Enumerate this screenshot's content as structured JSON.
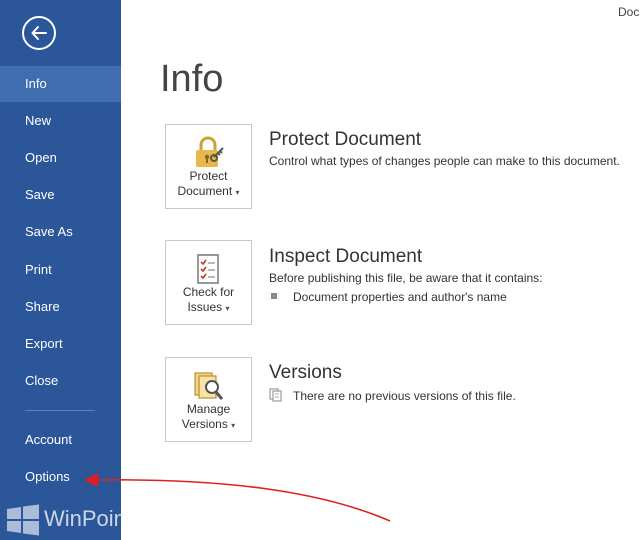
{
  "window": {
    "title_fragment": "Doc"
  },
  "sidebar": {
    "items": [
      {
        "label": "Info",
        "active": true
      },
      {
        "label": "New"
      },
      {
        "label": "Open"
      },
      {
        "label": "Save"
      },
      {
        "label": "Save As"
      },
      {
        "label": "Print"
      },
      {
        "label": "Share"
      },
      {
        "label": "Export"
      },
      {
        "label": "Close"
      },
      {
        "label": "Account"
      },
      {
        "label": "Options"
      }
    ],
    "accent_color": "#2b579a",
    "active_color": "#3f6db0"
  },
  "watermark": {
    "text": "WinPoin"
  },
  "main": {
    "title": "Info",
    "sections": [
      {
        "button_line1": "Protect",
        "button_line2": "Document",
        "heading": "Protect Document",
        "description": "Control what types of changes people can make to this document."
      },
      {
        "button_line1": "Check for",
        "button_line2": "Issues",
        "heading": "Inspect Document",
        "description": "Before publishing this file, be aware that it contains:",
        "bullet": "Document properties and author's name"
      },
      {
        "button_line1": "Manage",
        "button_line2": "Versions",
        "heading": "Versions",
        "note": "There are no previous versions of this file."
      }
    ]
  },
  "icons": {
    "back": "back-arrow-icon",
    "protect": "lock-key-icon",
    "inspect": "checklist-inspect-icon",
    "versions": "document-magnifier-icon",
    "watermark_logo": "windows-logo-icon"
  },
  "annotation": {
    "arrow_color": "#e02020"
  }
}
